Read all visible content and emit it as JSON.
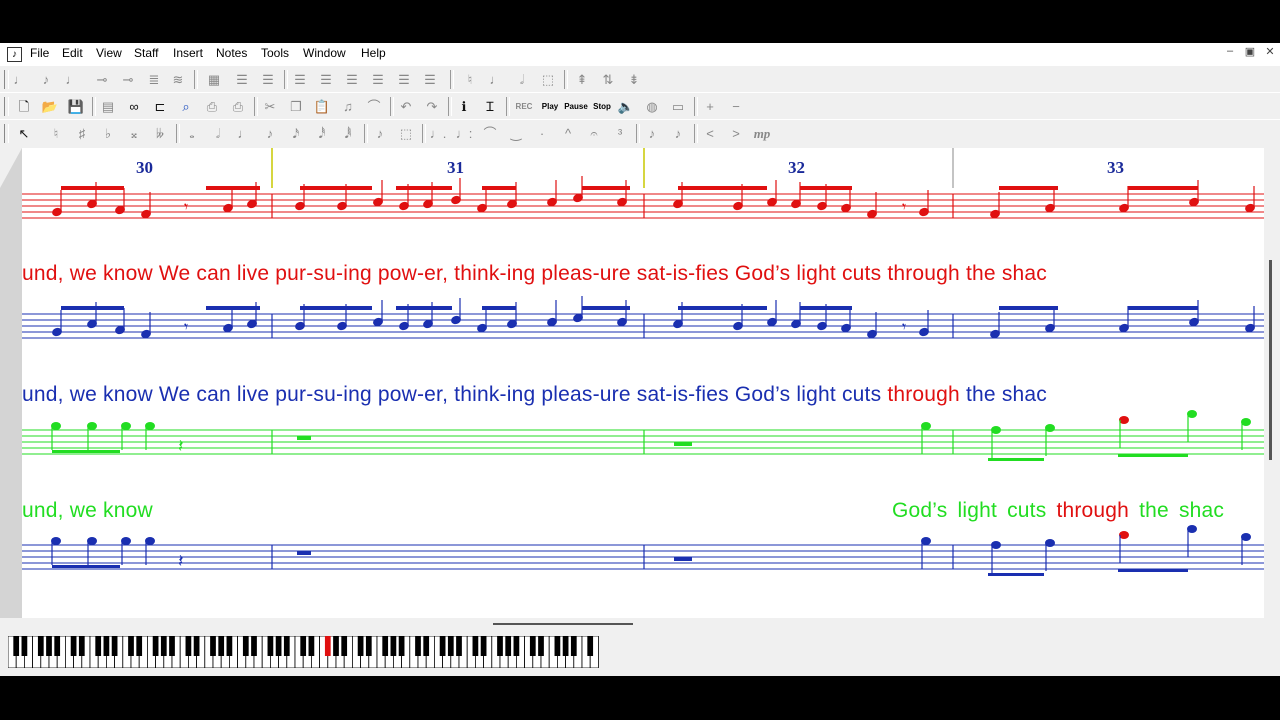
{
  "menu": {
    "items": [
      "File",
      "Edit",
      "View",
      "Staff",
      "Insert",
      "Notes",
      "Tools",
      "Window",
      "Help"
    ]
  },
  "window_controls": {
    "minimize": "–",
    "restore": "▣",
    "close": "✕"
  },
  "toolbar": {
    "play_label": "Play",
    "pause_label": "Pause",
    "stop_label": "Stop",
    "rec_label": "REC",
    "dynamic_label": "mp"
  },
  "score": {
    "measures": [
      "30",
      "31",
      "32",
      "33"
    ],
    "staves": [
      {
        "name": "soprano",
        "color": "#e01010",
        "lyrics": [
          {
            "text": "und,",
            "color": "#e01010"
          },
          {
            "text": "we",
            "color": "#e01010"
          },
          {
            "text": "know",
            "color": "#e01010"
          },
          {
            "text": "We",
            "color": "#e01010"
          },
          {
            "text": "can",
            "color": "#e01010"
          },
          {
            "text": "live",
            "color": "#e01010"
          },
          {
            "text": "pur-su-ing",
            "color": "#e01010"
          },
          {
            "text": "pow-er,",
            "color": "#e01010"
          },
          {
            "text": "think-ing",
            "color": "#e01010"
          },
          {
            "text": "pleas-ure",
            "color": "#e01010"
          },
          {
            "text": "sat-is-fies",
            "color": "#e01010"
          },
          {
            "text": "God’s",
            "color": "#e01010"
          },
          {
            "text": "light",
            "color": "#e01010"
          },
          {
            "text": "cuts",
            "color": "#e01010"
          },
          {
            "text": "through",
            "color": "#e01010"
          },
          {
            "text": "the",
            "color": "#e01010"
          },
          {
            "text": "shac",
            "color": "#e01010"
          }
        ]
      },
      {
        "name": "alto",
        "color": "#1a2fb0",
        "lyrics": [
          {
            "text": "und,",
            "color": "#1a2fb0"
          },
          {
            "text": "we",
            "color": "#1a2fb0"
          },
          {
            "text": "know",
            "color": "#1a2fb0"
          },
          {
            "text": "We",
            "color": "#1a2fb0"
          },
          {
            "text": "can",
            "color": "#1a2fb0"
          },
          {
            "text": "live",
            "color": "#1a2fb0"
          },
          {
            "text": "pur-su-ing",
            "color": "#1a2fb0"
          },
          {
            "text": "pow-er,",
            "color": "#1a2fb0"
          },
          {
            "text": "think-ing",
            "color": "#1a2fb0"
          },
          {
            "text": "pleas-ure",
            "color": "#1a2fb0"
          },
          {
            "text": "sat-is-fies",
            "color": "#1a2fb0"
          },
          {
            "text": "God’s",
            "color": "#1a2fb0"
          },
          {
            "text": "light",
            "color": "#1a2fb0"
          },
          {
            "text": "cuts",
            "color": "#1a2fb0"
          },
          {
            "text": "through",
            "color": "#e01010"
          },
          {
            "text": "the",
            "color": "#1a2fb0"
          },
          {
            "text": "shac",
            "color": "#1a2fb0"
          }
        ]
      },
      {
        "name": "tenor",
        "color": "#22dd22",
        "lyrics": [
          {
            "text": "und,",
            "color": "#22dd22"
          },
          {
            "text": "we",
            "color": "#22dd22"
          },
          {
            "text": "know",
            "color": "#22dd22"
          },
          {
            "text": "God’s",
            "color": "#22dd22"
          },
          {
            "text": "light",
            "color": "#22dd22"
          },
          {
            "text": "cuts",
            "color": "#22dd22"
          },
          {
            "text": "through",
            "color": "#e01010"
          },
          {
            "text": "the",
            "color": "#22dd22"
          },
          {
            "text": "shac",
            "color": "#22dd22"
          }
        ]
      },
      {
        "name": "bass",
        "color": "#1a2fb0",
        "lyrics": []
      }
    ]
  },
  "piano": {
    "highlighted_key_color": "#e01010"
  }
}
